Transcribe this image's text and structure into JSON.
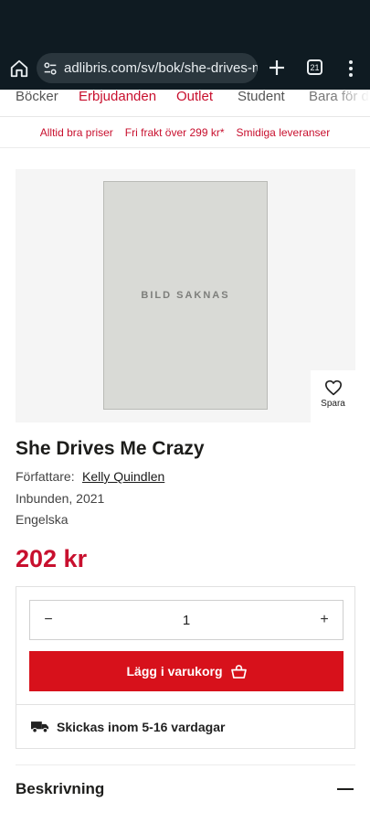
{
  "browser": {
    "url": "adlibris.com/sv/bok/she-drives-me",
    "tab_count": "21",
    "icons": [
      "home-icon",
      "site-settings-icon",
      "new-tab-icon",
      "tab-switcher-icon",
      "overflow-menu-icon"
    ]
  },
  "nav": {
    "categories": [
      "Böcker",
      "Erbjudanden",
      "Outlet",
      "Student",
      "Bara för dig"
    ]
  },
  "usp": {
    "items": [
      "Alltid bra priser",
      "Fri frakt över 299 kr*",
      "Smidiga leveranser"
    ]
  },
  "product": {
    "image_placeholder": "BILD SAKNAS",
    "save_label": "Spara",
    "title": "She Drives Me Crazy",
    "author_label": "Författare:",
    "author": "Kelly Quindlen",
    "format": "Inbunden, 2021",
    "language": "Engelska",
    "price": "202 kr"
  },
  "buy": {
    "quantity": "1",
    "decrement": "−",
    "increment": "+",
    "add_to_cart": "Lägg i varukorg",
    "shipping": "Skickas inom 5-16 vardagar"
  },
  "description": {
    "title": "Beskrivning"
  },
  "colors": {
    "brand_red": "#c8102e",
    "button_red": "#d7111b",
    "chrome_dark": "#0f1b22"
  }
}
